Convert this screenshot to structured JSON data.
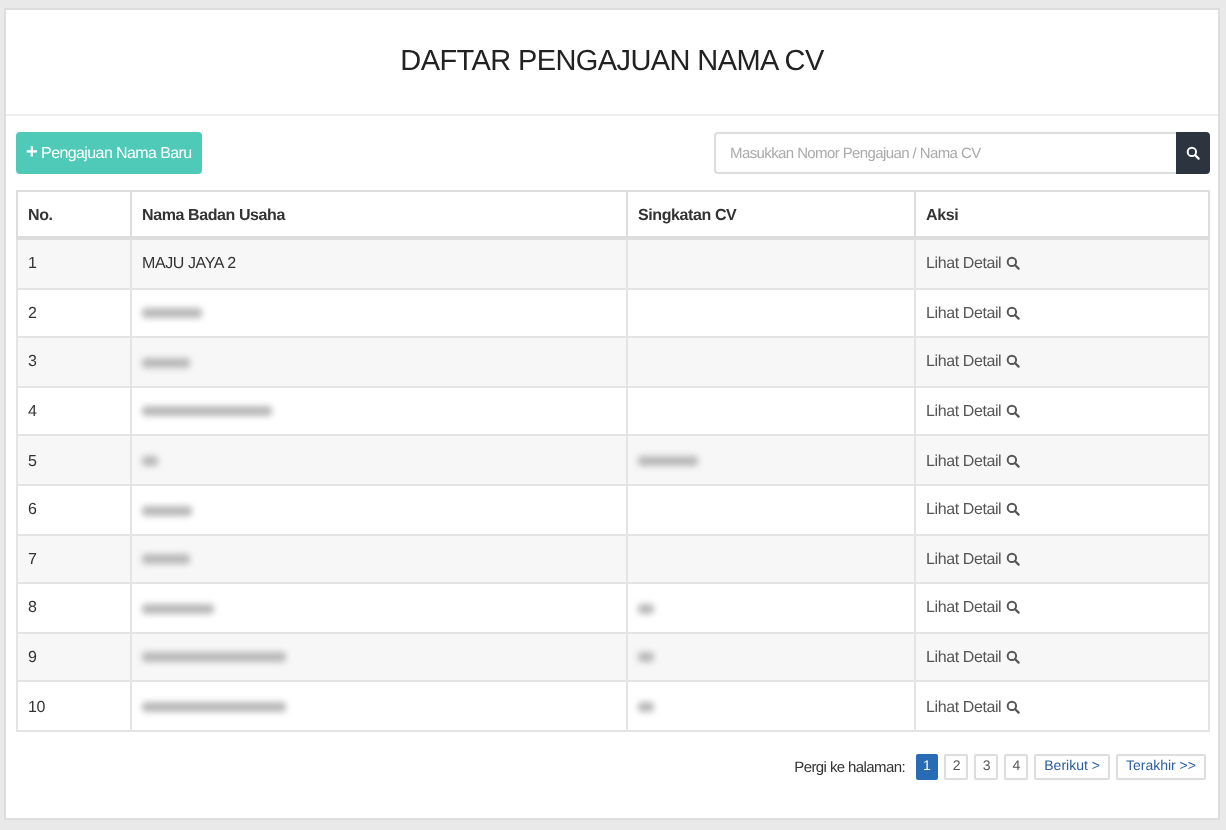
{
  "title": "DAFTAR PENGAJUAN NAMA CV",
  "new_button": {
    "icon": "+",
    "label": "Pengajuan Nama Baru"
  },
  "search": {
    "placeholder": "Masukkan Nomor Pengajuan / Nama CV"
  },
  "table": {
    "columns": [
      "No.",
      "Nama Badan Usaha",
      "Singkatan CV",
      "Aksi"
    ],
    "rows": [
      {
        "no": "1",
        "name": {
          "text": "MAJU JAYA 2"
        },
        "action": "Lihat Detail"
      },
      {
        "no": "2",
        "name": {
          "redacted": true
        },
        "action": "Lihat Detail"
      },
      {
        "no": "3",
        "name": {
          "redacted": true
        },
        "action": "Lihat Detail"
      },
      {
        "no": "4",
        "name": {
          "redacted": true
        },
        "action": "Lihat Detail"
      },
      {
        "no": "5",
        "name": {
          "redacted": true
        },
        "short": {
          "redacted": true
        },
        "action": "Lihat Detail"
      },
      {
        "no": "6",
        "name": {
          "redacted": true
        },
        "action": "Lihat Detail"
      },
      {
        "no": "7",
        "name": {
          "redacted": true
        },
        "action": "Lihat Detail"
      },
      {
        "no": "8",
        "name": {
          "redacted": true
        },
        "short": {
          "redacted": true
        },
        "action": "Lihat Detail"
      },
      {
        "no": "9",
        "name": {
          "redacted": true
        },
        "short": {
          "redacted": true
        },
        "action": "Lihat Detail"
      },
      {
        "no": "10",
        "name": {
          "redacted": true
        },
        "short": {
          "redacted": true
        },
        "action": "Lihat Detail"
      }
    ]
  },
  "pagination": {
    "label": "Pergi ke halaman:",
    "pages": [
      {
        "label": "1",
        "selected": true
      },
      {
        "label": "2",
        "selected": false
      },
      {
        "label": "3",
        "selected": false
      },
      {
        "label": "4",
        "selected": false
      }
    ],
    "next": "Berikut >",
    "last": "Terakhir >>"
  }
}
